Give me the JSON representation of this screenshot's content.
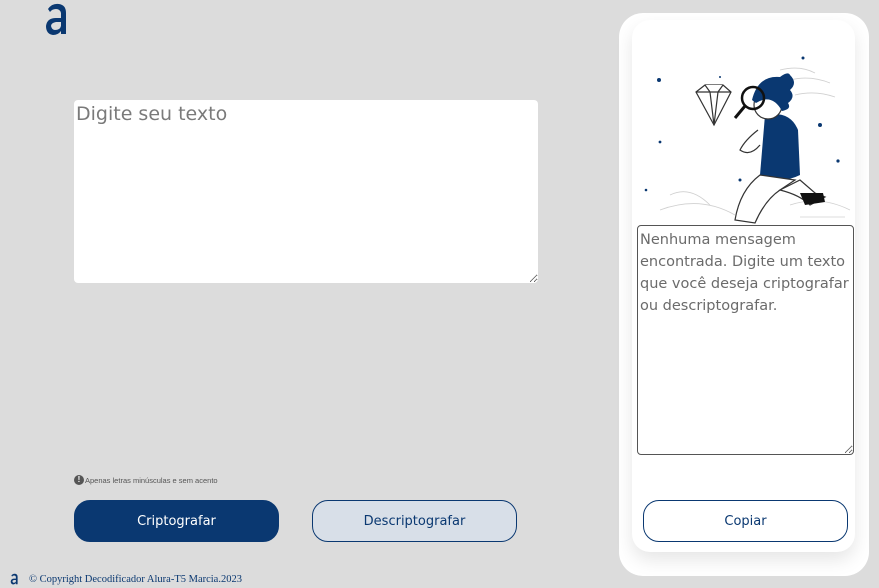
{
  "brand": {
    "logo_icon": "alura-logo-icon",
    "color": "#0a3871"
  },
  "input": {
    "placeholder": "Digite seu texto",
    "value": ""
  },
  "hint": {
    "icon": "info-icon",
    "text": "Apenas letras minúsculas e sem acento"
  },
  "buttons": {
    "encrypt": "Criptografar",
    "decrypt": "Descriptografar",
    "copy": "Copiar"
  },
  "output": {
    "placeholder": "Nenhuma mensagem encontrada. Digite um texto que você deseja criptografar ou descriptografar.",
    "value": ""
  },
  "illustration": {
    "icon": "person-with-magnifying-glass-illustration"
  },
  "footer": {
    "text": "© Copyright Decodificador Alura-T5 Marcia.2023"
  },
  "colors": {
    "background": "#dcdcdc",
    "primary": "#0a3871",
    "secondary_button_bg": "#d8dfe8",
    "panel": "#ffffff"
  }
}
